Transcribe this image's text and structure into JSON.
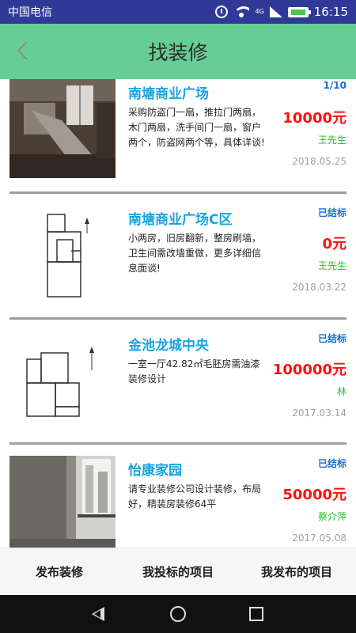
{
  "status_bar": {
    "carrier": "中国电信",
    "network": "4G",
    "time": "16:15"
  },
  "header": {
    "title": "找装修"
  },
  "listings": [
    {
      "name": "南塘商业广场",
      "description": "采购防盗门一扇，推拉门两扇，木门两扇，洗手间门一扇，窗户两个，防盗网两个等，具体详谈!",
      "status": "1/10",
      "price": "10000元",
      "owner": "王先生",
      "date": "2018.05.25",
      "image": "room-photo"
    },
    {
      "name": "南塘商业广场C区",
      "description": "小两房，旧房翻新，整房刷墙，卫生间需改墙重做，更多详细信息面谈!",
      "status": "已结标",
      "price": "0元",
      "owner": "王先生",
      "date": "2018.03.22",
      "image": "floor-plan"
    },
    {
      "name": "金池龙城中央",
      "description": "一室一厅42.82㎡毛胚房需油漆装修设计",
      "status": "已结标",
      "price": "100000元",
      "owner": "林",
      "date": "2017.03.14",
      "image": "floor-plan"
    },
    {
      "name": "怡康家园",
      "description": "请专业装修公司设计装修，布局好，精装房装修64平",
      "status": "已结标",
      "price": "50000元",
      "owner": "蔡介萍",
      "date": "2017.05.08",
      "image": "room-photo"
    }
  ],
  "bottom_tabs": [
    "发布装修",
    "我投标的项目",
    "我发布的项目"
  ],
  "colors": {
    "header_bg": "#66cd95",
    "status_bar_bg": "#2f3a98",
    "name": "#18a4e0",
    "price": "#ff1010",
    "owner": "#20c12f",
    "status": "#1b6ed2"
  }
}
